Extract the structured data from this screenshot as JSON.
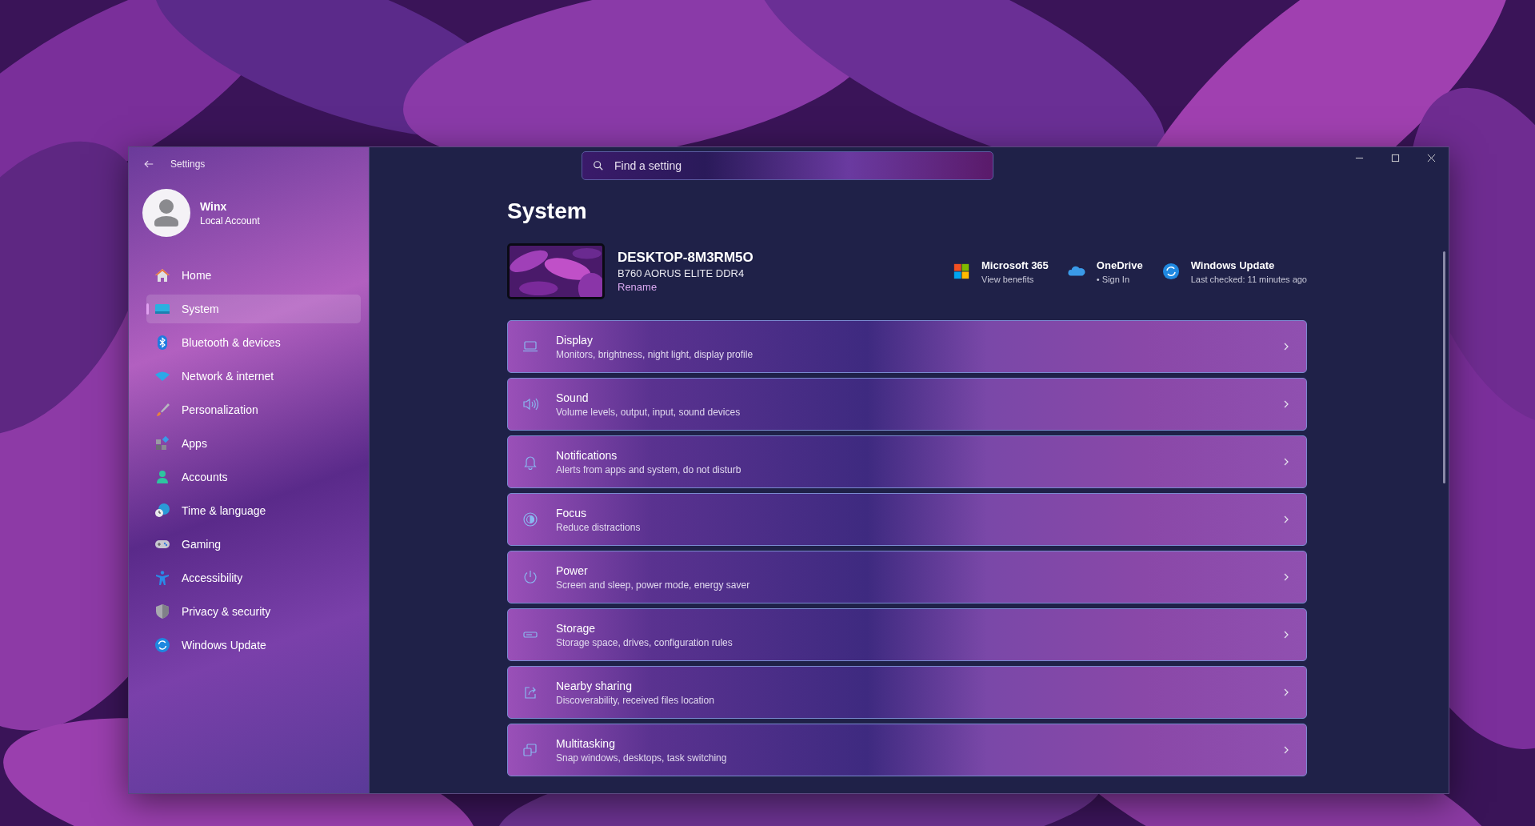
{
  "window": {
    "title": "Settings"
  },
  "user": {
    "name": "Winx",
    "account": "Local Account"
  },
  "sidebar": {
    "items": [
      {
        "label": "Home",
        "selected": false
      },
      {
        "label": "System",
        "selected": true
      },
      {
        "label": "Bluetooth & devices",
        "selected": false
      },
      {
        "label": "Network & internet",
        "selected": false
      },
      {
        "label": "Personalization",
        "selected": false
      },
      {
        "label": "Apps",
        "selected": false
      },
      {
        "label": "Accounts",
        "selected": false
      },
      {
        "label": "Time & language",
        "selected": false
      },
      {
        "label": "Gaming",
        "selected": false
      },
      {
        "label": "Accessibility",
        "selected": false
      },
      {
        "label": "Privacy & security",
        "selected": false
      },
      {
        "label": "Windows Update",
        "selected": false
      }
    ]
  },
  "search": {
    "placeholder": "Find a setting"
  },
  "page_title": "System",
  "device": {
    "name": "DESKTOP-8M3RM5O",
    "model": "B760 AORUS ELITE DDR4",
    "rename": "Rename"
  },
  "services": [
    {
      "title": "Microsoft 365",
      "subtitle": "View benefits"
    },
    {
      "title": "OneDrive",
      "subtitle": "• Sign In"
    },
    {
      "title": "Windows Update",
      "subtitle": "Last checked: 11 minutes ago"
    }
  ],
  "settings": [
    {
      "title": "Display",
      "subtitle": "Monitors, brightness, night light, display profile"
    },
    {
      "title": "Sound",
      "subtitle": "Volume levels, output, input, sound devices"
    },
    {
      "title": "Notifications",
      "subtitle": "Alerts from apps and system, do not disturb"
    },
    {
      "title": "Focus",
      "subtitle": "Reduce distractions"
    },
    {
      "title": "Power",
      "subtitle": "Screen and sleep, power mode, energy saver"
    },
    {
      "title": "Storage",
      "subtitle": "Storage space, drives, configuration rules"
    },
    {
      "title": "Nearby sharing",
      "subtitle": "Discoverability, received files location"
    },
    {
      "title": "Multitasking",
      "subtitle": "Snap windows, desktops, task switching"
    }
  ]
}
